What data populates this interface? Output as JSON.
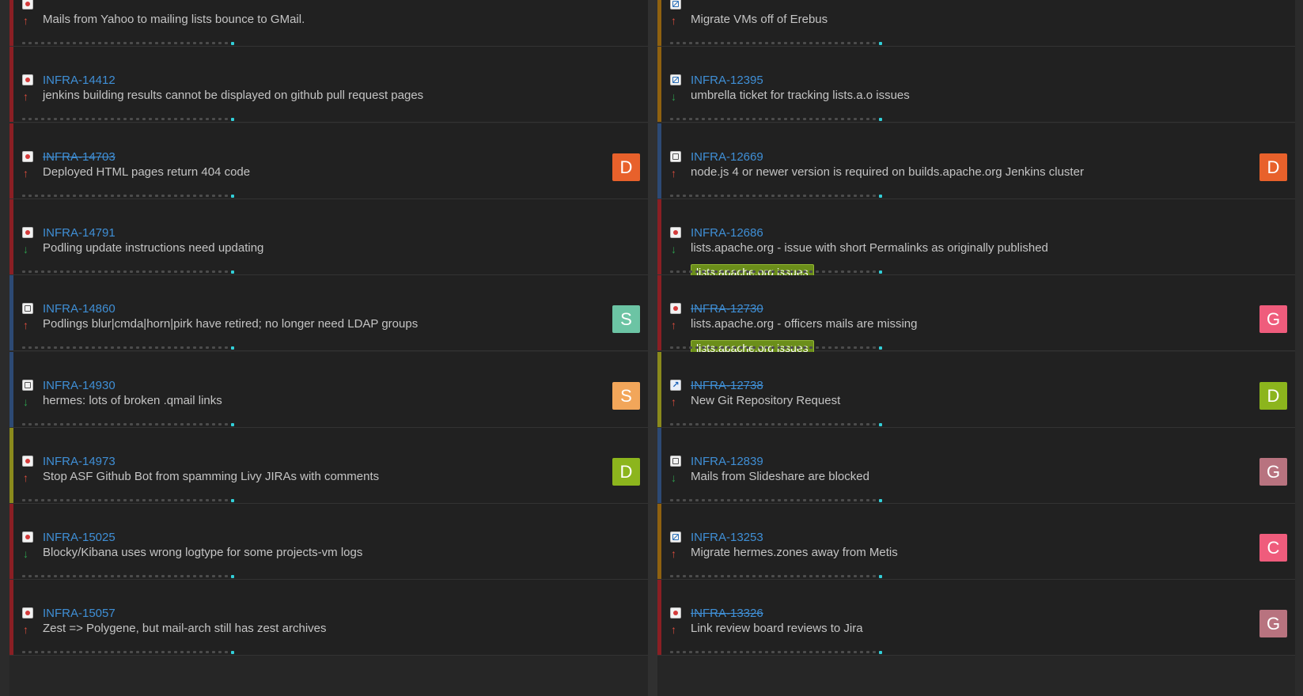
{
  "colors": {
    "stripe_red": "#8a1f24",
    "stripe_blue": "#2d4a74",
    "stripe_olive": "#8a8a1c",
    "stripe_amber": "#8f6110",
    "key_blue": "#3f8fd6",
    "label_green": "#6b8e1a",
    "progress_cyan": "#32cfd8"
  },
  "left_column": [
    {
      "key": "",
      "summary": "Mails from Yahoo to mailing lists bounce to GMail.",
      "type": "bug",
      "priority": "up",
      "resolved": false,
      "stripe": "red",
      "avatar": null,
      "label": null
    },
    {
      "key": "INFRA-14412",
      "summary": "jenkins building results cannot be displayed on github pull request pages",
      "type": "bug",
      "priority": "up",
      "resolved": false,
      "stripe": "red",
      "avatar": null,
      "label": null
    },
    {
      "key": "INFRA-14703",
      "summary": "Deployed HTML pages return 404 code",
      "type": "bug",
      "priority": "up",
      "resolved": true,
      "stripe": "red",
      "avatar": {
        "letter": "D",
        "color": "#e8612b"
      },
      "label": null
    },
    {
      "key": "INFRA-14791",
      "summary": "Podling update instructions need updating",
      "type": "bug",
      "priority": "down",
      "resolved": false,
      "stripe": "red",
      "avatar": null,
      "label": null
    },
    {
      "key": "INFRA-14860",
      "summary": "Podlings blur|cmda|horn|pirk have retired; no longer need LDAP groups",
      "type": "task",
      "priority": "up",
      "resolved": false,
      "stripe": "blue",
      "avatar": {
        "letter": "S",
        "color": "#6cc4a4"
      },
      "label": null
    },
    {
      "key": "INFRA-14930",
      "summary": "hermes: lots of broken .qmail links",
      "type": "task",
      "priority": "down",
      "resolved": false,
      "stripe": "blue",
      "avatar": {
        "letter": "S",
        "color": "#f2a65a"
      },
      "label": null
    },
    {
      "key": "INFRA-14973",
      "summary": "Stop ASF Github Bot from spamming Livy JIRAs with comments",
      "type": "bug",
      "priority": "up",
      "resolved": false,
      "stripe": "olive",
      "avatar": {
        "letter": "D",
        "color": "#8cb51d"
      },
      "label": null
    },
    {
      "key": "INFRA-15025",
      "summary": "Blocky/Kibana uses wrong logtype for some projects-vm logs",
      "type": "bug",
      "priority": "down",
      "resolved": false,
      "stripe": "red",
      "avatar": null,
      "label": null
    },
    {
      "key": "INFRA-15057",
      "summary": "Zest => Polygene, but mail-arch still has zest archives",
      "type": "bug",
      "priority": "up",
      "resolved": false,
      "stripe": "red",
      "avatar": null,
      "label": null
    }
  ],
  "right_column": [
    {
      "key": "",
      "summary": "Migrate VMs off of Erebus",
      "type": "subtask",
      "priority": "up",
      "resolved": false,
      "stripe": "amber",
      "avatar": null,
      "label": null
    },
    {
      "key": "INFRA-12395",
      "summary": "umbrella ticket for tracking lists.a.o issues",
      "type": "subtask",
      "priority": "down",
      "resolved": false,
      "stripe": "amber",
      "avatar": null,
      "label": null
    },
    {
      "key": "INFRA-12669",
      "summary": "node.js 4 or newer version is required on builds.apache.org Jenkins cluster",
      "type": "task",
      "priority": "up",
      "resolved": false,
      "stripe": "blue",
      "avatar": {
        "letter": "D",
        "color": "#e8612b"
      },
      "label": null
    },
    {
      "key": "INFRA-12686",
      "summary": "lists.apache.org - issue with short Permalinks as originally published",
      "type": "bug",
      "priority": "down",
      "resolved": false,
      "stripe": "red",
      "avatar": null,
      "label": "lists.apache.org issues"
    },
    {
      "key": "INFRA-12730",
      "summary": "lists.apache.org - officers mails are missing",
      "type": "bug",
      "priority": "up",
      "resolved": true,
      "stripe": "red",
      "avatar": {
        "letter": "G",
        "color": "#ef5c7c"
      },
      "label": "lists.apache.org issues"
    },
    {
      "key": "INFRA-12738",
      "summary": "New Git Repository Request",
      "type": "improvement",
      "priority": "up",
      "resolved": true,
      "stripe": "olive",
      "avatar": {
        "letter": "D",
        "color": "#8cb51d"
      },
      "label": null
    },
    {
      "key": "INFRA-12839",
      "summary": "Mails from Slideshare are blocked",
      "type": "task",
      "priority": "down",
      "resolved": false,
      "stripe": "blue",
      "avatar": {
        "letter": "G",
        "color": "#b8737f"
      },
      "label": null
    },
    {
      "key": "INFRA-13253",
      "summary": "Migrate hermes.zones away from Metis",
      "type": "subtask",
      "priority": "up",
      "resolved": false,
      "stripe": "amber",
      "avatar": {
        "letter": "C",
        "color": "#ef5c7c"
      },
      "label": null
    },
    {
      "key": "INFRA-13326",
      "summary": "Link review board reviews to Jira",
      "type": "bug",
      "priority": "up",
      "resolved": true,
      "stripe": "red",
      "avatar": {
        "letter": "G",
        "color": "#b8737f"
      },
      "label": null
    }
  ]
}
